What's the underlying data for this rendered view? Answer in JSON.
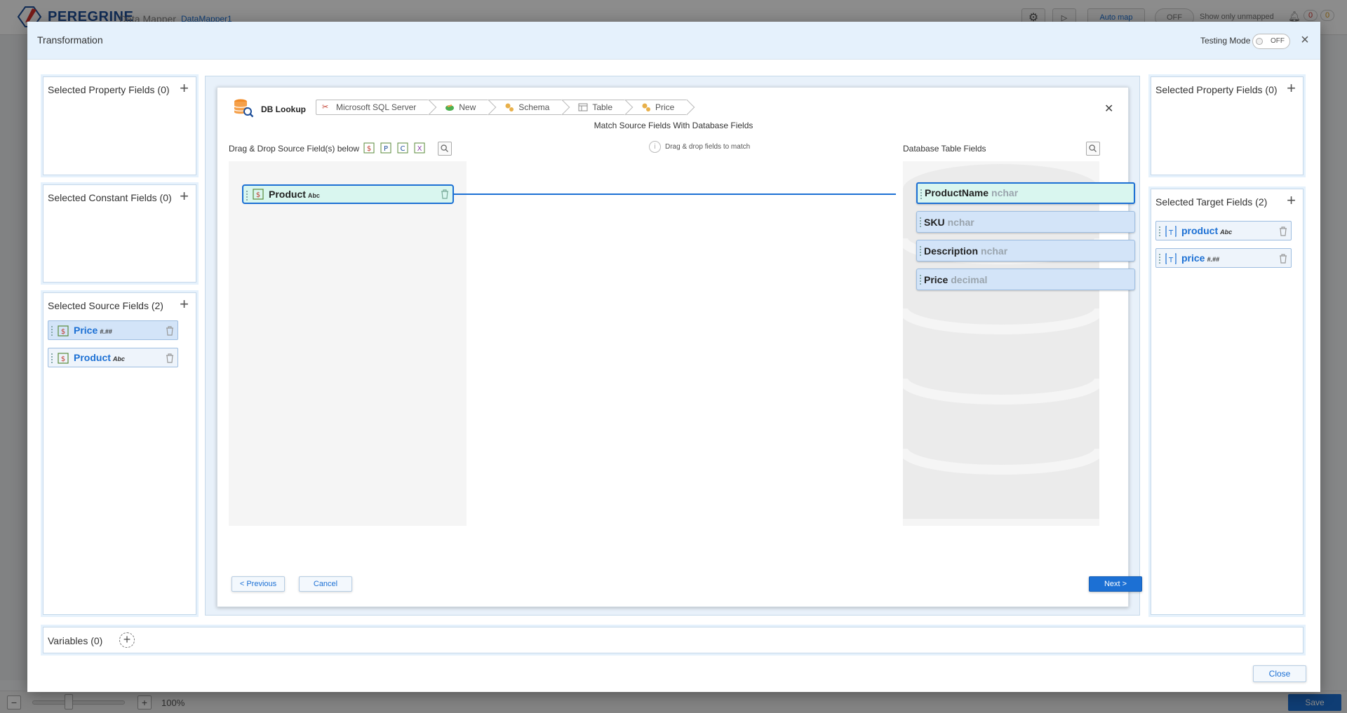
{
  "app": {
    "logo_text": "PEREGRINE",
    "app_name": "Data Mapper",
    "file_name": "DataMapper1",
    "auto_map_label": "Auto map",
    "off_label": "OFF",
    "show_unmapped_label": "Show only unmapped",
    "badge_errors": "0",
    "badge_warnings": "0",
    "zoom_level": "100%",
    "save_label": "Save"
  },
  "dialog": {
    "title": "Transformation",
    "testing_mode_label": "Testing Mode",
    "testing_mode_state": "OFF",
    "close_label": "Close"
  },
  "left_panels": {
    "property": {
      "title": "Selected Property Fields (0)"
    },
    "constant": {
      "title": "Selected Constant Fields (0)"
    },
    "source": {
      "title": "Selected Source Fields (2)",
      "items": [
        {
          "name": "Price",
          "type": "#.##"
        },
        {
          "name": "Product",
          "type": "Abc"
        }
      ]
    }
  },
  "right_panels": {
    "property": {
      "title": "Selected Property Fields (0)"
    },
    "target": {
      "title": "Selected Target Fields (2)",
      "items": [
        {
          "name": "product",
          "type": "Abc"
        },
        {
          "name": "price",
          "type": "#.##"
        }
      ]
    }
  },
  "variables": {
    "label": "Variables (0)"
  },
  "wizard": {
    "title": "DB Lookup",
    "breadcrumbs": [
      "Microsoft SQL Server",
      "New",
      "Schema",
      "Table",
      "Price"
    ],
    "subtitle": "Match Source Fields With Database Fields",
    "source_label": "Drag & Drop Source Field(s) below",
    "hint": "Drag & drop fields to match",
    "db_label": "Database Table Fields",
    "source_dropped": {
      "name": "Product",
      "type": "Abc"
    },
    "db_fields": [
      {
        "name": "ProductName",
        "type": "nchar"
      },
      {
        "name": "SKU",
        "type": "nchar"
      },
      {
        "name": "Description",
        "type": "nchar"
      },
      {
        "name": "Price",
        "type": "decimal"
      }
    ],
    "prev_label": "< Previous",
    "cancel_label": "Cancel",
    "next_label": "Next >"
  },
  "colors": {
    "accent": "#1c70d4",
    "header_bg": "#e5f1fc",
    "match_bg": "#d9f6ef"
  }
}
